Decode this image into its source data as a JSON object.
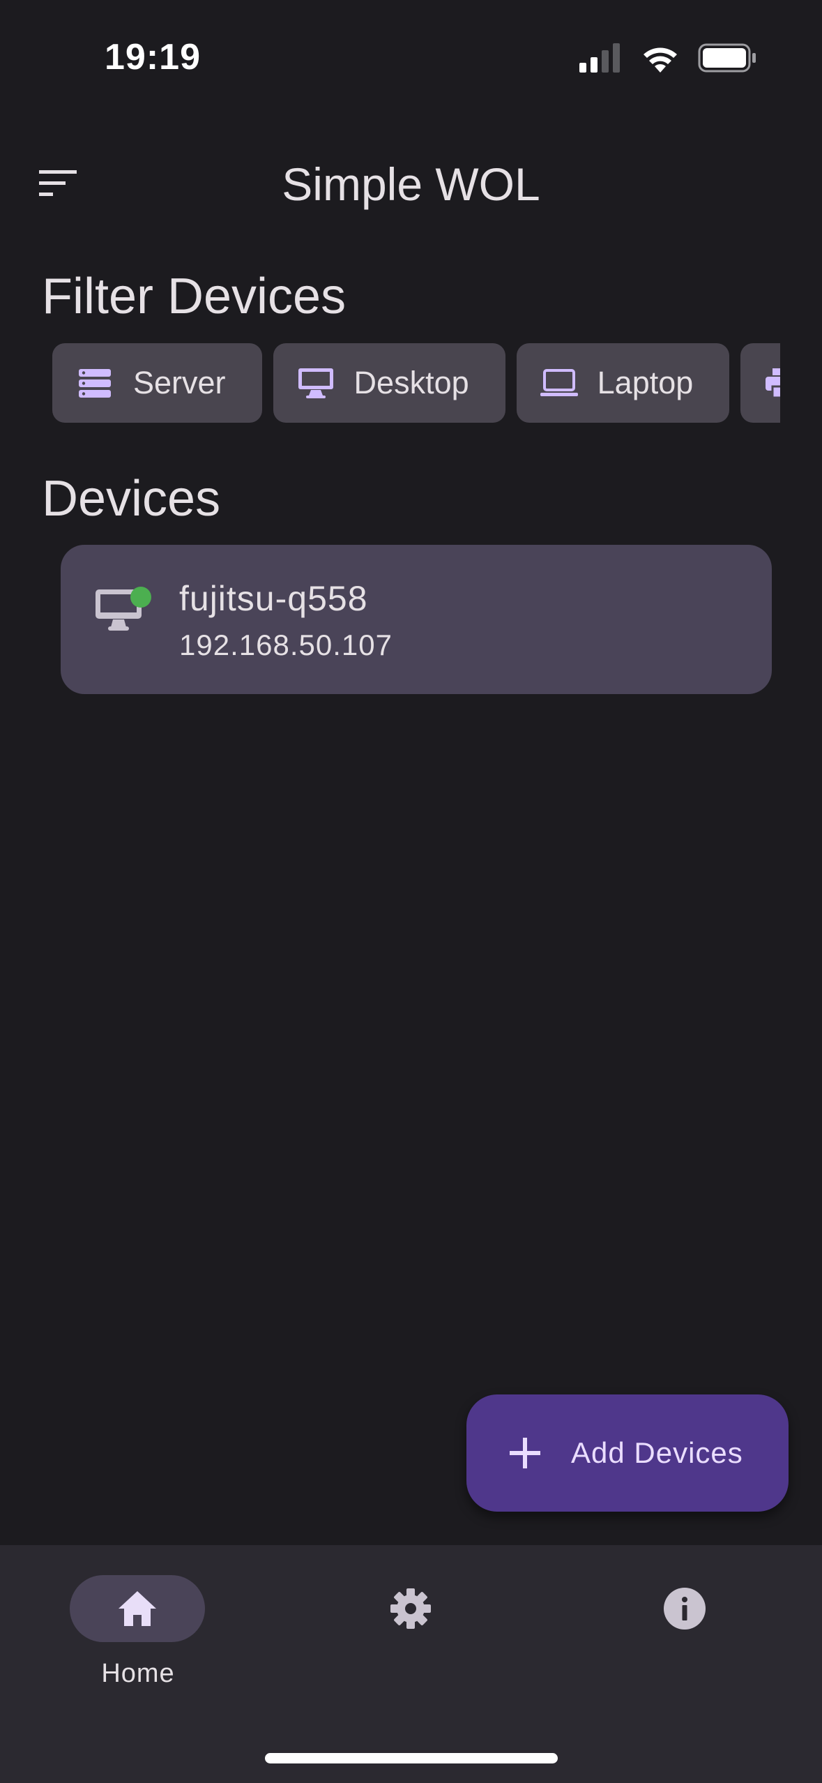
{
  "status_bar": {
    "time": "19:19"
  },
  "app_bar": {
    "title": "Simple WOL"
  },
  "filter_section": {
    "title": "Filter Devices",
    "chips": [
      {
        "label": "Server",
        "icon": "server-icon"
      },
      {
        "label": "Desktop",
        "icon": "desktop-icon"
      },
      {
        "label": "Laptop",
        "icon": "laptop-icon"
      },
      {
        "label": "",
        "icon": "printer-icon"
      }
    ]
  },
  "devices_section": {
    "title": "Devices",
    "items": [
      {
        "name": "fujitsu-q558",
        "ip": "192.168.50.107",
        "status": "online",
        "icon": "desktop-icon"
      }
    ]
  },
  "fab": {
    "label": "Add Devices",
    "icon": "plus-icon"
  },
  "bottom_nav": {
    "items": [
      {
        "label": "Home",
        "icon": "home-icon",
        "selected": true
      },
      {
        "label": "",
        "icon": "gear-icon",
        "selected": false
      },
      {
        "label": "",
        "icon": "info-icon",
        "selected": false
      }
    ]
  },
  "colors": {
    "background": "#1c1b1f",
    "chip": "#49454f",
    "card": "#4a4458",
    "fab": "#4f378b",
    "accent_icon": "#d0bcff",
    "online": "#4caf50",
    "nav_bar": "#2b2930"
  }
}
